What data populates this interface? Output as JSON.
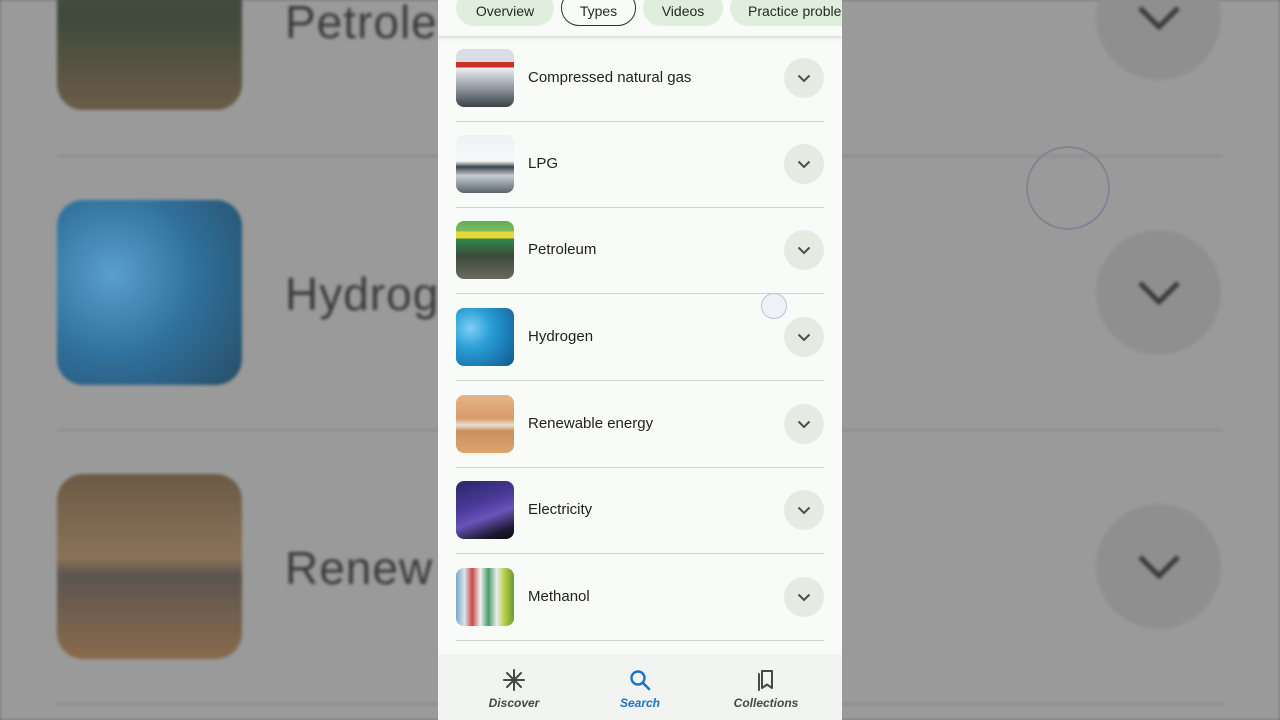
{
  "backdrop": {
    "rows": [
      "Petrole",
      "Hydrog",
      "Renew"
    ]
  },
  "tabs": [
    {
      "label": "Overview",
      "active": false
    },
    {
      "label": "Types",
      "active": true
    },
    {
      "label": "Videos",
      "active": false
    },
    {
      "label": "Practice proble",
      "active": false
    }
  ],
  "types": [
    {
      "label": "Compressed natural gas",
      "icon": "expand-chevron-icon"
    },
    {
      "label": "LPG",
      "icon": "expand-chevron-icon"
    },
    {
      "label": "Petroleum",
      "icon": "expand-chevron-icon"
    },
    {
      "label": "Hydrogen",
      "icon": "expand-chevron-icon"
    },
    {
      "label": "Renewable energy",
      "icon": "expand-chevron-icon"
    },
    {
      "label": "Electricity",
      "icon": "expand-chevron-icon"
    },
    {
      "label": "Methanol",
      "icon": "expand-chevron-icon"
    }
  ],
  "bottom_nav": {
    "discover": "Discover",
    "search": "Search",
    "collections": "Collections",
    "active": "search"
  },
  "colors": {
    "active_nav": "#1a73c9",
    "chip_bg": "#dfeedd",
    "panel_bg": "#f8fbf7"
  }
}
